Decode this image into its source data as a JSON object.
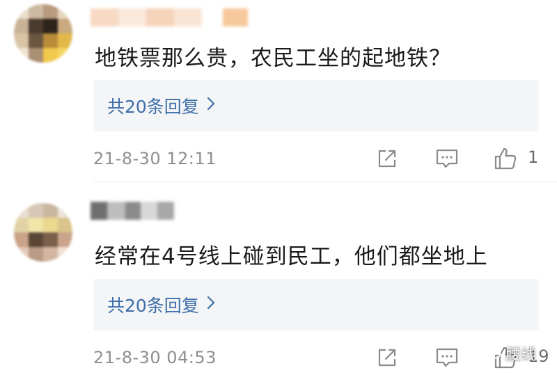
{
  "comments": [
    {
      "text": "地铁票那么贵，农民工坐的起地铁？",
      "replies_label": "共20条回复",
      "timestamp": "21-8-30 12:11",
      "like_count": "1"
    },
    {
      "text": "经常在4号线上碰到民工，他们都坐地上",
      "replies_label": "共20条回复",
      "timestamp": "21-8-30 04:53",
      "like_count": "19"
    }
  ],
  "icons": {
    "share": "share-icon",
    "reply": "comment-icon",
    "like": "thumbs-up-icon",
    "chevron": "chevron-right-icon",
    "watermark": "wechat-logo-icon"
  },
  "watermark": {
    "text": "腰线"
  },
  "colors": {
    "text": "#1a1a1a",
    "link": "#3d6ea8",
    "meta": "#8e8e8e",
    "reply_box_bg": "#f4f5f7",
    "icon": "#8a8a8a"
  }
}
